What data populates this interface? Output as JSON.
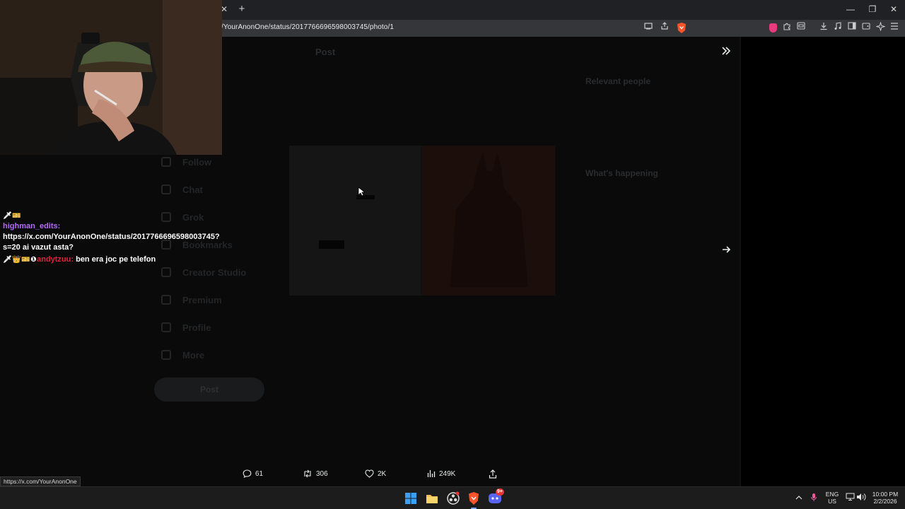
{
  "browser": {
    "url": "/YourAnonOne/status/2017766696598003745/photo/1",
    "tab_close_glyph": "✕",
    "new_tab_glyph": "+",
    "window_controls": [
      "—",
      "❐",
      "✕"
    ],
    "hover_status_url": "https://x.com/YourAnonOne"
  },
  "tweet": {
    "stats": {
      "replies": "61",
      "reposts": "306",
      "likes": "2K",
      "views": "249K"
    },
    "dim_header": "Post",
    "dim_nav": [
      "Follow",
      "Chat",
      "Grok",
      "Bookmarks",
      "Creator Studio",
      "Premium",
      "Profile",
      "More"
    ],
    "dim_post_button": "Post",
    "dim_relevant_people": "Relevant people",
    "dim_whats_happening": "What's happening"
  },
  "chat": {
    "messages": [
      {
        "badges": "🗡🎫",
        "user": "highman_edits:",
        "text": "https://x.com/YourAnonOne/status/2017766696598003745?s=20 ai vazut asta?",
        "user_color": "#b56bff"
      },
      {
        "badges": "🗡👑🎫❶",
        "user": "andytzuu:",
        "text": "ben era joc pe telefon",
        "user_color": "#e0223b"
      }
    ]
  },
  "taskbar": {
    "lang_top": "ENG",
    "lang_bottom": "US",
    "time": "10:00 PM",
    "date": "2/2/2026",
    "discord_badge": "9+"
  },
  "icons": {
    "reply": "reply-icon",
    "repost": "repost-icon",
    "like": "heart-icon",
    "views": "views-icon",
    "share": "share-icon",
    "expand": "chevrons-right-icon",
    "next": "arrow-right-icon"
  },
  "colors": {
    "accent_brave": "#fb542b",
    "chat_purple": "#b56bff",
    "chat_red": "#e0223b"
  }
}
